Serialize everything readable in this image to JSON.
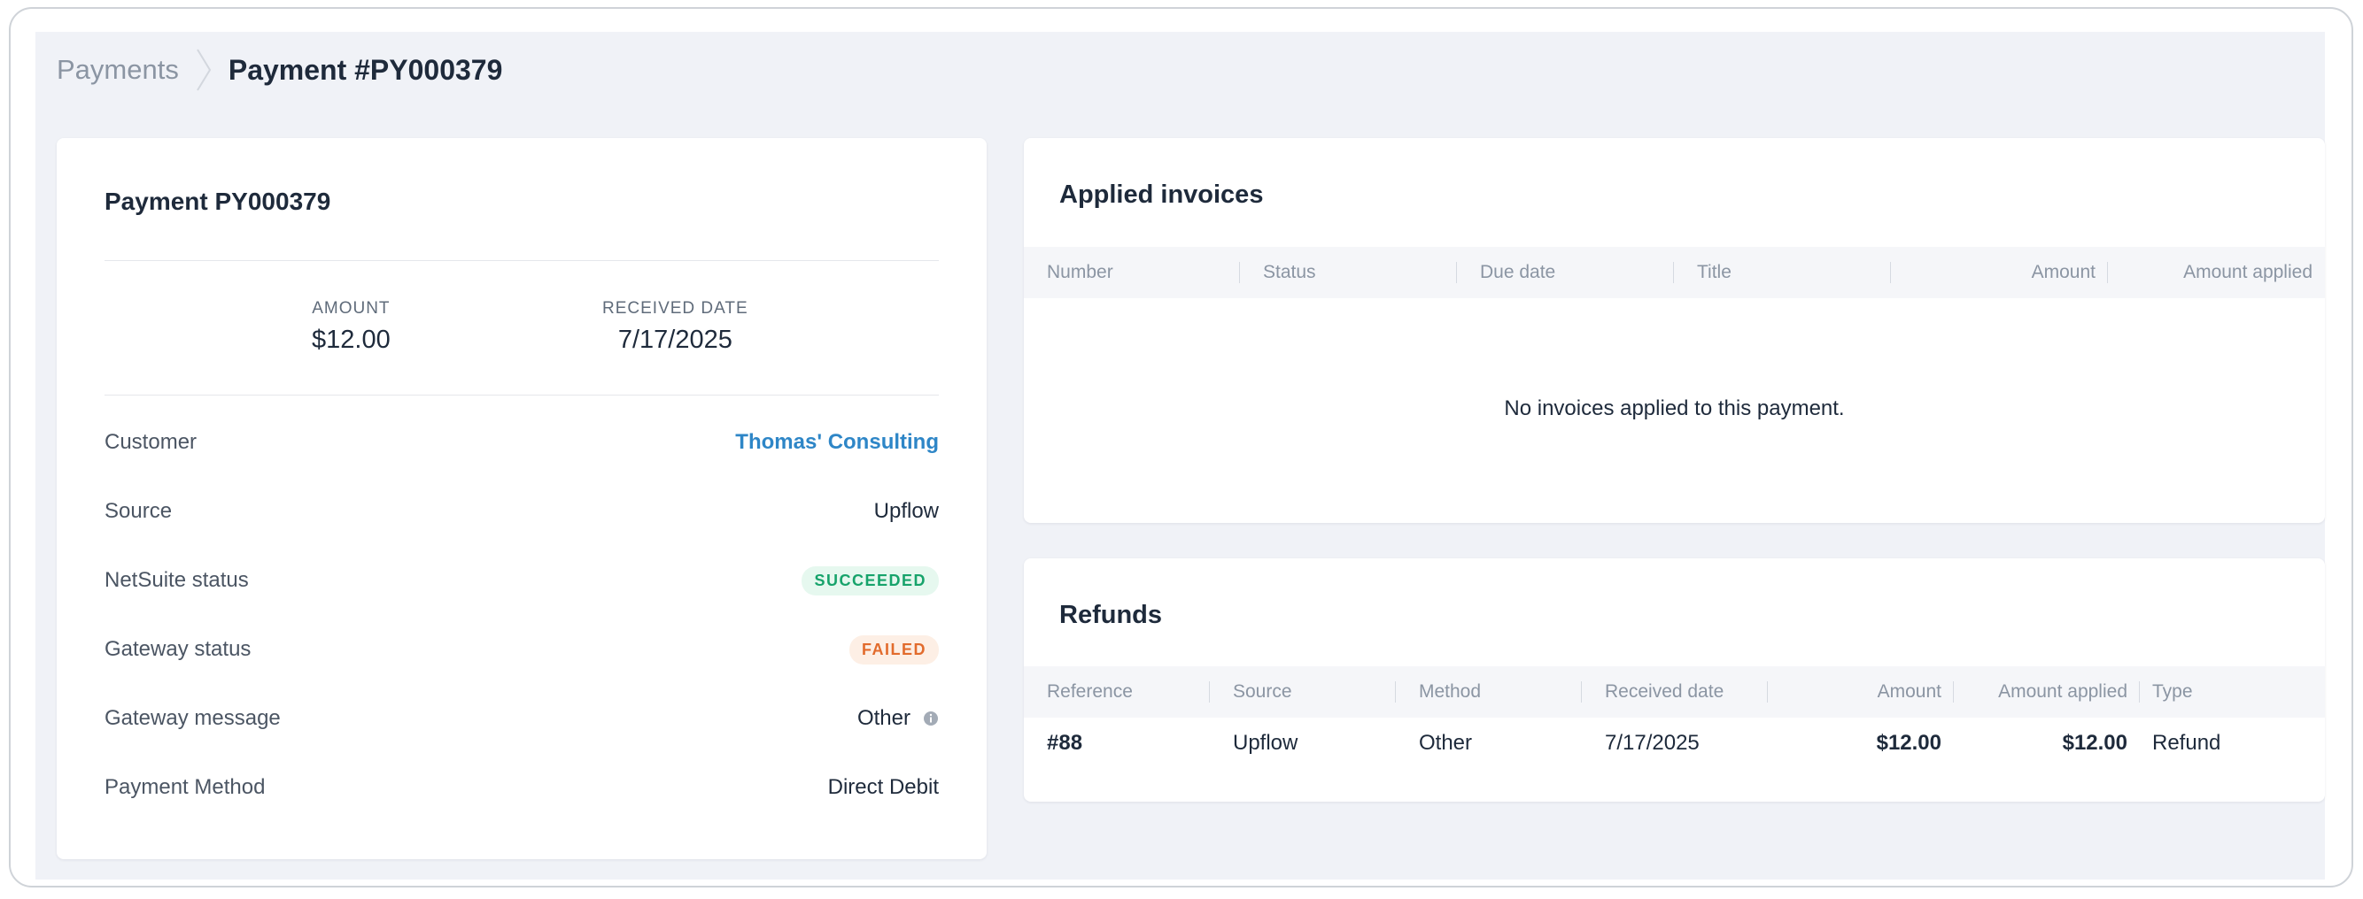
{
  "breadcrumb": {
    "parent": "Payments",
    "current": "Payment #PY000379"
  },
  "detail": {
    "heading": "Payment PY000379",
    "amount_label": "AMOUNT",
    "amount_value": "$12.00",
    "received_label": "RECEIVED DATE",
    "received_value": "7/17/2025",
    "rows": [
      {
        "label": "Customer",
        "value": "Thomas' Consulting"
      },
      {
        "label": "Source",
        "value": "Upflow"
      },
      {
        "label": "NetSuite status",
        "value": "SUCCEEDED"
      },
      {
        "label": "Gateway status",
        "value": "FAILED"
      },
      {
        "label": "Gateway message",
        "value": "Other"
      },
      {
        "label": "Payment Method",
        "value": "Direct Debit"
      }
    ]
  },
  "invoices": {
    "title": "Applied invoices",
    "columns": [
      "Number",
      "Status",
      "Due date",
      "Title",
      "Amount",
      "Amount applied"
    ],
    "empty_message": "No invoices applied to this payment."
  },
  "refunds": {
    "title": "Refunds",
    "columns": [
      "Reference",
      "Source",
      "Method",
      "Received date",
      "Amount",
      "Amount applied",
      "Type"
    ],
    "rows": [
      {
        "reference": "#88",
        "source": "Upflow",
        "method": "Other",
        "received_date": "7/17/2025",
        "amount": "$12.00",
        "amount_applied": "$12.00",
        "type": "Refund"
      }
    ]
  },
  "colors": {
    "accent_link": "#2e86c7",
    "success": "#17a36b",
    "failed": "#e26b2c",
    "background": "#f0f2f7"
  },
  "icons": {
    "breadcrumb_separator": "chevron-right-icon",
    "gateway_message_info": "info-icon"
  }
}
